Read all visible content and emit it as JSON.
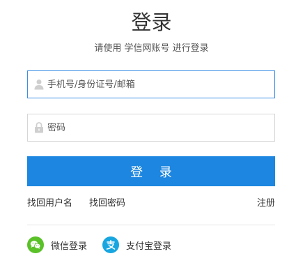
{
  "header": {
    "title": "登录",
    "subtitle": "请使用 学信网账号 进行登录"
  },
  "form": {
    "username_placeholder": "手机号/身份证号/邮箱",
    "password_placeholder": "密码",
    "login_label": "登 录"
  },
  "links": {
    "find_username": "找回用户名",
    "find_password": "找回密码",
    "register": "注册"
  },
  "third_party": {
    "wechat_label": "微信登录",
    "alipay_label": "支付宝登录"
  },
  "colors": {
    "accent": "#1c86e0",
    "focus_border": "#3a8ee6",
    "wechat": "#5ac128",
    "alipay": "#18a6e0"
  },
  "icons": [
    "user-icon",
    "lock-icon",
    "wechat-icon",
    "alipay-icon"
  ]
}
